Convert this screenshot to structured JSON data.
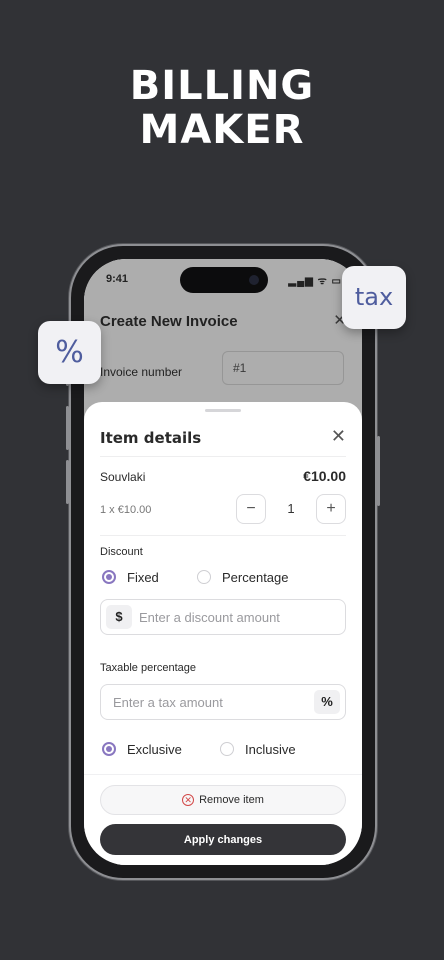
{
  "hero": {
    "line1": "BILLING",
    "line2": "MAKER"
  },
  "badges": {
    "percent": "%",
    "tax": "tax"
  },
  "status_bar": {
    "time": "9:41",
    "icons": "▂▄▆ ᯤ ▭"
  },
  "background_screen": {
    "title": "Create New Invoice",
    "close": "✕",
    "invoice_number_label": "Invoice number",
    "invoice_number_value": "#1"
  },
  "sheet": {
    "title": "Item details",
    "close": "✕",
    "item": {
      "name": "Souvlaki",
      "price": "€10.00",
      "unit_summary": "1 x €10.00"
    },
    "stepper": {
      "minus": "−",
      "value": "1",
      "plus": "+"
    },
    "discount": {
      "label": "Discount",
      "options": [
        {
          "label": "Fixed",
          "selected": true
        },
        {
          "label": "Percentage",
          "selected": false
        }
      ],
      "adornment": "$",
      "placeholder": "Enter a discount amount"
    },
    "tax": {
      "label": "Taxable percentage",
      "placeholder": "Enter a tax amount",
      "adornment": "%",
      "options": [
        {
          "label": "Exclusive",
          "selected": true
        },
        {
          "label": "Inclusive",
          "selected": false
        }
      ]
    },
    "remove_icon": "✕",
    "remove_label": "Remove item",
    "apply_label": "Apply changes"
  },
  "colors": {
    "background": "#313236",
    "accent": "#8977c0",
    "badge_text": "#4f5d9e",
    "danger": "#d24848",
    "primary_button": "#343438"
  }
}
